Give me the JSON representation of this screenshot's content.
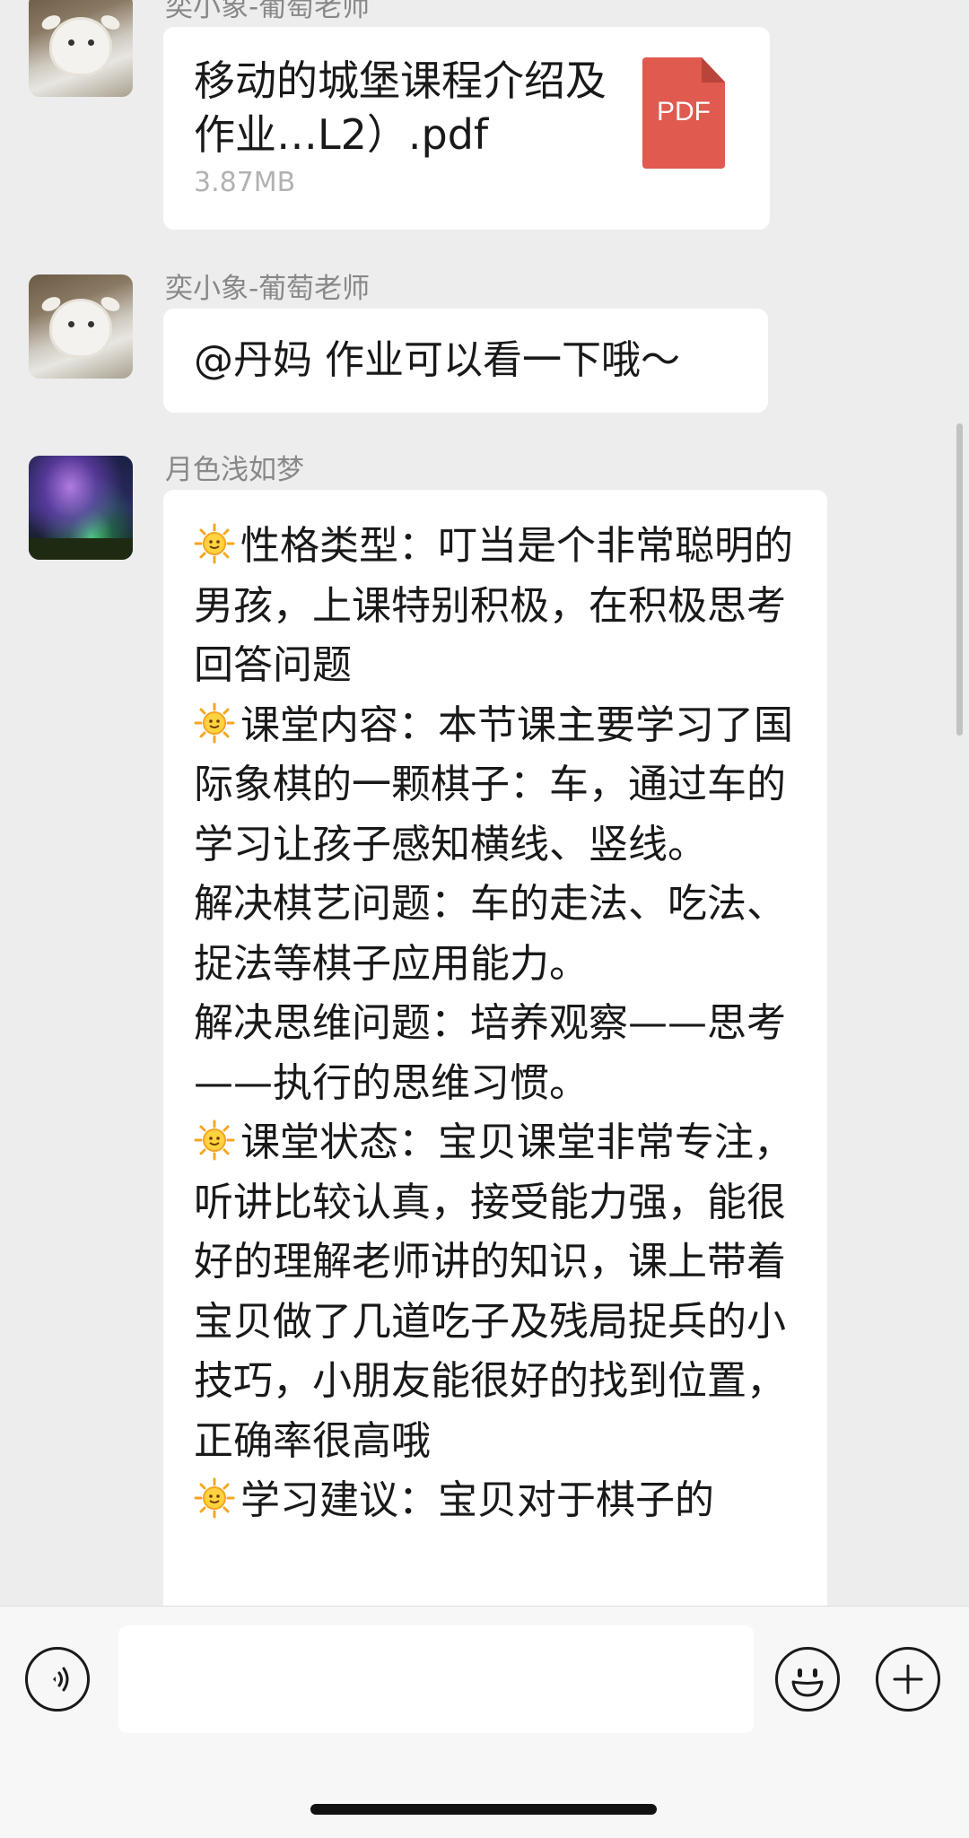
{
  "messages": [
    {
      "sender": "奕小象-葡萄老师",
      "file": {
        "name": "移动的城堡课程介绍及作业…L2）.pdf",
        "size": "3.87MB",
        "type_label": "PDF"
      }
    },
    {
      "sender": "奕小象-葡萄老师",
      "text": "@丹妈 作业可以看一下哦～"
    },
    {
      "sender": "月色浅如梦",
      "sections": [
        {
          "icon": "sun-emoji",
          "text": "性格类型：叮当是个非常聪明的男孩，上课特别积极，在积极思考回答问题"
        },
        {
          "icon": "sun-emoji",
          "text": "课堂内容：本节课主要学习了国际象棋的一颗棋子：车，通过车的学习让孩子感知横线、竖线。"
        },
        {
          "icon": "",
          "text": "解决棋艺问题：车的走法、吃法、捉法等棋子应用能力。"
        },
        {
          "icon": "",
          "text": "解决思维问题：培养观察——思考——执行的思维习惯。"
        },
        {
          "icon": "sun-emoji",
          "text": "课堂状态：宝贝课堂非常专注，听讲比较认真，接受能力强，能很好的理解老师讲的知识，课上带着宝贝做了几道吃子及残局捉兵的小技巧，小朋友能很好的找到位置，正确率很高哦"
        },
        {
          "icon": "sun-emoji",
          "text": "学习建议：宝贝对于棋子的"
        }
      ]
    }
  ],
  "input_bar": {
    "voice_icon": "voice-icon",
    "input_placeholder": "",
    "emoji_icon": "emoji-icon",
    "plus_icon": "plus-icon"
  },
  "colors": {
    "background": "#ededed",
    "bubble": "#ffffff",
    "sender": "#888888",
    "pdf": "#e05a4f"
  }
}
